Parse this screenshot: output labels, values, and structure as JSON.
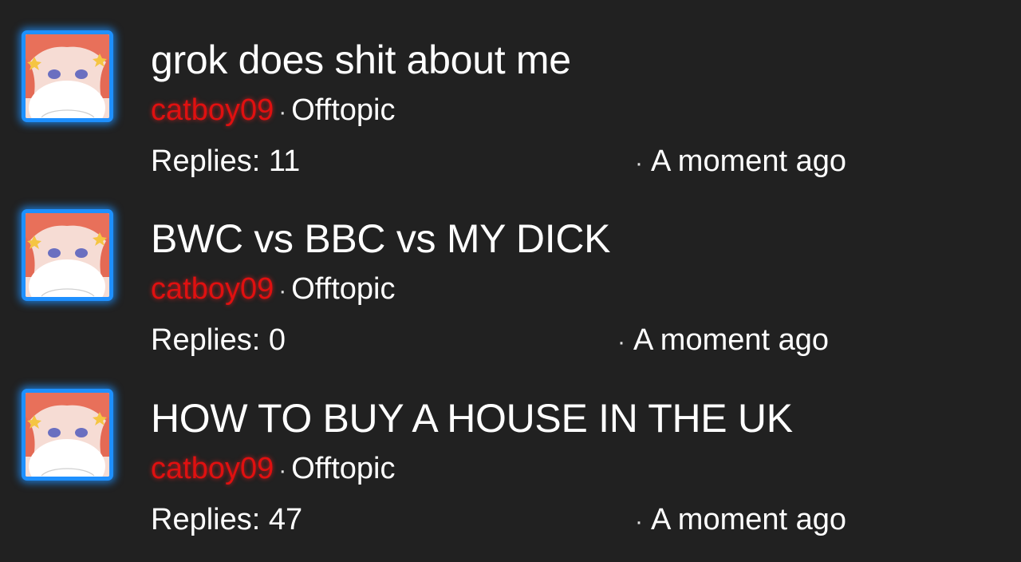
{
  "threads": [
    {
      "title": "grok does shit about me",
      "author": "catboy09",
      "separator": "·",
      "category": "Offtopic",
      "replies": "Replies: 11",
      "time": "A moment ago"
    },
    {
      "title": "BWC vs BBC vs MY DICK",
      "author": "catboy09",
      "separator": "·",
      "category": "Offtopic",
      "replies": "Replies: 0",
      "time": "A moment ago"
    },
    {
      "title": "HOW TO BUY A HOUSE IN THE UK",
      "author": "catboy09",
      "separator": "·",
      "category": "Offtopic",
      "replies": "Replies: 47",
      "time": "A moment ago"
    }
  ],
  "colors": {
    "background": "#212121",
    "author": "#e01010",
    "avatar_border": "#1e90ff",
    "text": "#ffffff"
  },
  "icons": {
    "avatar": "anime-avatar-image"
  }
}
